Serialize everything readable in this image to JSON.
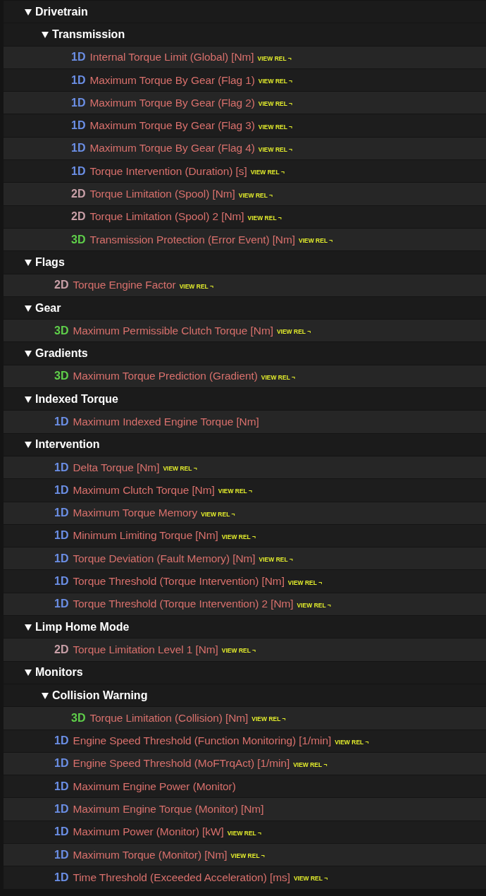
{
  "tree": [
    {
      "kind": "group",
      "label": "Drivetrain",
      "expanded": true,
      "children": [
        {
          "kind": "group",
          "label": "Transmission",
          "expanded": true,
          "children": [
            {
              "kind": "item",
              "dim": "1D",
              "color": "#6b8fe6",
              "name": "Internal Torque Limit (Global) [Nm]",
              "link": "VIEW REL ¬"
            },
            {
              "kind": "item",
              "dim": "1D",
              "color": "#6b8fe6",
              "name": "Maximum Torque By Gear (Flag 1)",
              "link": "VIEW REL ¬"
            },
            {
              "kind": "item",
              "dim": "1D",
              "color": "#6b8fe6",
              "name": "Maximum Torque By Gear (Flag 2)",
              "link": "VIEW REL ¬"
            },
            {
              "kind": "item",
              "dim": "1D",
              "color": "#6b8fe6",
              "name": "Maximum Torque By Gear (Flag 3)",
              "link": "VIEW REL ¬"
            },
            {
              "kind": "item",
              "dim": "1D",
              "color": "#6b8fe6",
              "name": "Maximum Torque By Gear (Flag 4)",
              "link": "VIEW REL ¬"
            },
            {
              "kind": "item",
              "dim": "1D",
              "color": "#6b8fe6",
              "name": "Torque Intervention (Duration) [s]",
              "link": "VIEW REL ¬"
            },
            {
              "kind": "item",
              "dim": "2D",
              "color": "#c9a0a8",
              "name": "Torque Limitation (Spool) [Nm]",
              "link": "VIEW REL ¬"
            },
            {
              "kind": "item",
              "dim": "2D",
              "color": "#c9a0a8",
              "name": "Torque Limitation (Spool) 2 [Nm]",
              "link": "VIEW REL ¬"
            },
            {
              "kind": "item",
              "dim": "3D",
              "color": "#5fcf4a",
              "name": "Transmission Protection (Error Event) [Nm]",
              "link": "VIEW REL ¬"
            }
          ]
        }
      ]
    },
    {
      "kind": "group",
      "label": "Flags",
      "expanded": true,
      "children": [
        {
          "kind": "item",
          "dim": "2D",
          "color": "#c9a0a8",
          "name": "Torque Engine Factor",
          "link": "VIEW REL ¬"
        }
      ]
    },
    {
      "kind": "group",
      "label": "Gear",
      "expanded": true,
      "children": [
        {
          "kind": "item",
          "dim": "3D",
          "color": "#5fcf4a",
          "name": "Maximum Permissible Clutch Torque [Nm]",
          "link": "VIEW REL ¬"
        }
      ]
    },
    {
      "kind": "group",
      "label": "Gradients",
      "expanded": true,
      "children": [
        {
          "kind": "item",
          "dim": "3D",
          "color": "#5fcf4a",
          "name": "Maximum Torque Prediction (Gradient)",
          "link": "VIEW REL ¬"
        }
      ]
    },
    {
      "kind": "group",
      "label": "Indexed Torque",
      "expanded": true,
      "children": [
        {
          "kind": "item",
          "dim": "1D",
          "color": "#6b8fe6",
          "name": "Maximum Indexed Engine Torque [Nm]"
        }
      ]
    },
    {
      "kind": "group",
      "label": "Intervention",
      "expanded": true,
      "children": [
        {
          "kind": "item",
          "dim": "1D",
          "color": "#6b8fe6",
          "name": "Delta Torque [Nm]",
          "link": "VIEW REL ¬"
        },
        {
          "kind": "item",
          "dim": "1D",
          "color": "#6b8fe6",
          "name": "Maximum Clutch Torque [Nm]",
          "link": "VIEW REL ¬"
        },
        {
          "kind": "item",
          "dim": "1D",
          "color": "#6b8fe6",
          "name": "Maximum Torque Memory",
          "link": "VIEW REL ¬"
        },
        {
          "kind": "item",
          "dim": "1D",
          "color": "#6b8fe6",
          "name": "Minimum Limiting Torque [Nm]",
          "link": "VIEW REL ¬"
        },
        {
          "kind": "item",
          "dim": "1D",
          "color": "#6b8fe6",
          "name": "Torque Deviation (Fault Memory) [Nm]",
          "link": "VIEW REL ¬"
        },
        {
          "kind": "item",
          "dim": "1D",
          "color": "#6b8fe6",
          "name": "Torque Threshold (Torque Intervention) [Nm]",
          "link": "VIEW REL ¬"
        },
        {
          "kind": "item",
          "dim": "1D",
          "color": "#6b8fe6",
          "name": "Torque Threshold (Torque Intervention) 2 [Nm]",
          "link": "VIEW REL ¬"
        }
      ]
    },
    {
      "kind": "group",
      "label": "Limp Home Mode",
      "expanded": true,
      "children": [
        {
          "kind": "item",
          "dim": "2D",
          "color": "#c9a0a8",
          "name": "Torque Limitation Level 1 [Nm]",
          "link": "VIEW REL ¬"
        }
      ]
    },
    {
      "kind": "group",
      "label": "Monitors",
      "expanded": true,
      "children": [
        {
          "kind": "group",
          "label": "Collision Warning",
          "expanded": true,
          "children": [
            {
              "kind": "item",
              "dim": "3D",
              "color": "#5fcf4a",
              "name": "Torque Limitation (Collision) [Nm]",
              "link": "VIEW REL ¬"
            }
          ]
        },
        {
          "kind": "item",
          "dim": "1D",
          "color": "#6b8fe6",
          "name": "Engine Speed Threshold (Function Monitoring) [1/min]",
          "link": "VIEW REL ¬"
        },
        {
          "kind": "item",
          "dim": "1D",
          "color": "#6b8fe6",
          "name": "Engine Speed Threshold (MoFTrqAct) [1/min]",
          "link": "VIEW REL ¬"
        },
        {
          "kind": "item",
          "dim": "1D",
          "color": "#6b8fe6",
          "name": "Maximum Engine Power (Monitor)"
        },
        {
          "kind": "item",
          "dim": "1D",
          "color": "#6b8fe6",
          "name": "Maximum Engine Torque (Monitor) [Nm]"
        },
        {
          "kind": "item",
          "dim": "1D",
          "color": "#6b8fe6",
          "name": "Maximum Power (Monitor) [kW]",
          "link": "VIEW REL ¬"
        },
        {
          "kind": "item",
          "dim": "1D",
          "color": "#6b8fe6",
          "name": "Maximum Torque (Monitor) [Nm]",
          "link": "VIEW REL ¬"
        },
        {
          "kind": "item",
          "dim": "1D",
          "color": "#6b8fe6",
          "name": "Time Threshold (Exceeded Acceleration) [ms]",
          "link": "VIEW REL ¬"
        }
      ]
    }
  ]
}
